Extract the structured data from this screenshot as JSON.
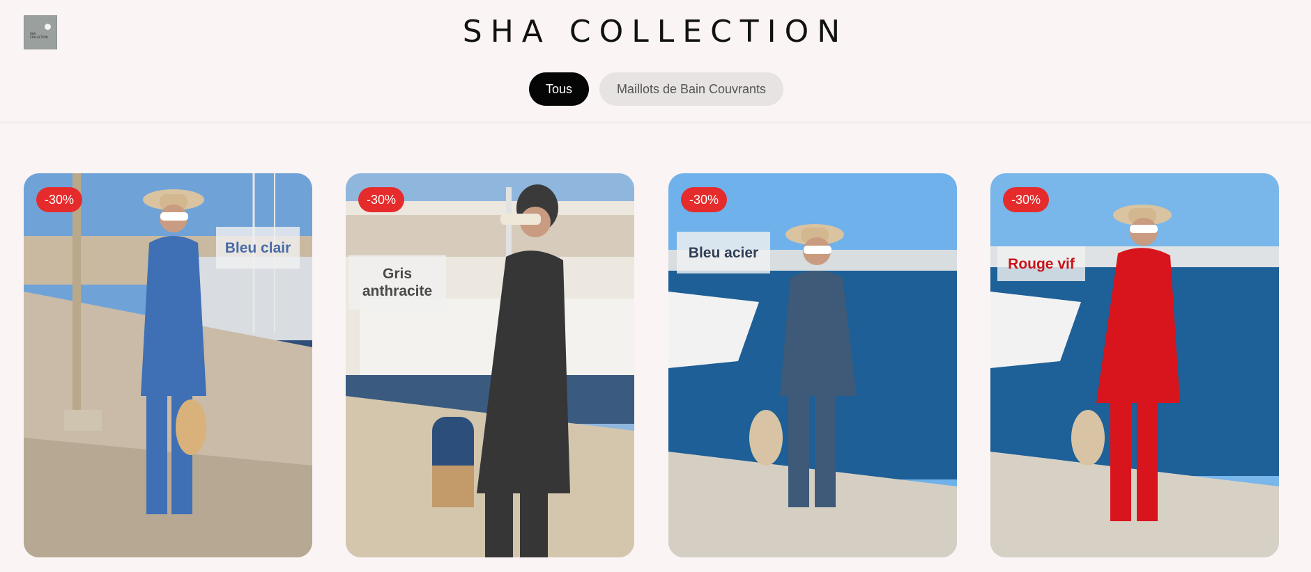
{
  "header": {
    "logo_text": "SHA COLLECTION",
    "title": "SHA COLLECTION"
  },
  "filters": [
    {
      "label": "Tous",
      "active": true
    },
    {
      "label": "Maillots de Bain Couvrants",
      "active": false
    }
  ],
  "products": [
    {
      "discount": "-30%",
      "color_name": "Bleu clair",
      "text_color": "#4a6aa5",
      "garment_color": "#3f6fb5"
    },
    {
      "discount": "-30%",
      "color_name": "Gris anthracite",
      "text_color": "#4a4a4a",
      "garment_color": "#363636"
    },
    {
      "discount": "-30%",
      "color_name": "Bleu acier",
      "text_color": "#2e3f57",
      "garment_color": "#3e5a78"
    },
    {
      "discount": "-30%",
      "color_name": "Rouge vif",
      "text_color": "#c8141a",
      "garment_color": "#d8141c"
    }
  ],
  "colors": {
    "background": "#faf4f4",
    "badge": "#e52b2b",
    "active_pill": "#050505",
    "inactive_pill": "#e6e3e2"
  }
}
